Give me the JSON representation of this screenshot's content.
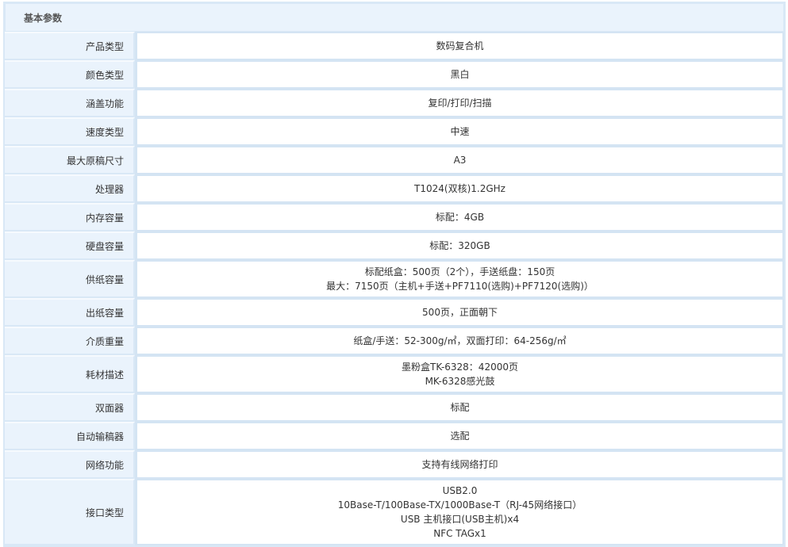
{
  "section_title": "基本参数",
  "rows": [
    {
      "label": "产品类型",
      "lines": [
        "数码复合机"
      ]
    },
    {
      "label": "颜色类型",
      "lines": [
        "黑白"
      ]
    },
    {
      "label": "涵盖功能",
      "lines": [
        "复印/打印/扫描"
      ]
    },
    {
      "label": "速度类型",
      "lines": [
        "中速"
      ]
    },
    {
      "label": "最大原稿尺寸",
      "lines": [
        "A3"
      ]
    },
    {
      "label": "处理器",
      "lines": [
        "T1024(双核)1.2GHz"
      ]
    },
    {
      "label": "内存容量",
      "lines": [
        "标配：4GB"
      ]
    },
    {
      "label": "硬盘容量",
      "lines": [
        "标配：320GB"
      ]
    },
    {
      "label": "供纸容量",
      "lines": [
        "标配纸盒：500页（2个），手送纸盘：150页",
        "最大：7150页（主机+手送+PF7110(选购)+PF7120(选购)）"
      ]
    },
    {
      "label": "出纸容量",
      "lines": [
        "500页，正面朝下"
      ]
    },
    {
      "label": "介质重量",
      "lines": [
        "纸盒/手送：52-300g/㎡，双面打印：64-256g/㎡"
      ]
    },
    {
      "label": "耗材描述",
      "lines": [
        "墨粉盒TK-6328：42000页",
        "MK-6328感光鼓"
      ]
    },
    {
      "label": "双面器",
      "lines": [
        "标配"
      ]
    },
    {
      "label": "自动输稿器",
      "lines": [
        "选配"
      ]
    },
    {
      "label": "网络功能",
      "lines": [
        "支持有线网络打印"
      ]
    },
    {
      "label": "接口类型",
      "lines": [
        "USB2.0",
        "10Base-T/100Base-TX/1000Base-T（RJ-45网络接口）",
        "USB 主机接口(USB主机)x4",
        "NFC TAGx1"
      ]
    }
  ]
}
